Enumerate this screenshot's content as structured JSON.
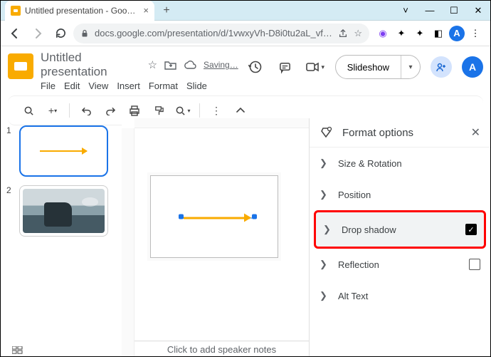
{
  "browser": {
    "tab_title": "Untitled presentation - Google Slides",
    "url": "docs.google.com/presentation/d/1vwxyVh-D8i0tu2aL_vfNHfpQv0…",
    "profile_initial": "A"
  },
  "app": {
    "title": "Untitled presentation",
    "status": "Saving…",
    "menus": [
      "File",
      "Edit",
      "View",
      "Insert",
      "Format",
      "Slide"
    ],
    "slideshow_label": "Slideshow",
    "user_initial": "A"
  },
  "slides": {
    "items": [
      {
        "num": "1",
        "selected": true,
        "kind": "arrow"
      },
      {
        "num": "2",
        "selected": false,
        "kind": "photo"
      }
    ]
  },
  "format_panel": {
    "title": "Format options",
    "sections": {
      "size": "Size & Rotation",
      "position": "Position",
      "drop_shadow": "Drop shadow",
      "reflection": "Reflection",
      "alt_text": "Alt Text"
    },
    "drop_shadow_checked": true,
    "reflection_checked": false
  },
  "notes_placeholder": "Click to add speaker notes"
}
